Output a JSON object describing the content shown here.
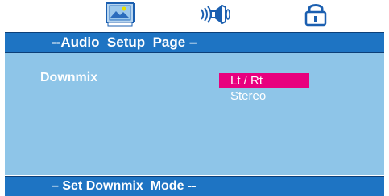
{
  "tabs": [
    {
      "icon": "video-setup-icon",
      "active": false
    },
    {
      "icon": "audio-speaker-icon",
      "active": true
    },
    {
      "icon": "padlock-icon",
      "active": false
    }
  ],
  "header": {
    "title": "--Audio  Setup  Page –"
  },
  "option": {
    "label": "Downmix",
    "values": [
      {
        "label": "Lt / Rt",
        "selected": true
      },
      {
        "label": "Stereo",
        "selected": false
      }
    ]
  },
  "footer": {
    "hint": "– Set Downmix  Mode --"
  },
  "colors": {
    "bar": "#1e74c3",
    "panel": "#8ec5e8",
    "highlight": "#e8007e",
    "text": "#ffffff"
  }
}
